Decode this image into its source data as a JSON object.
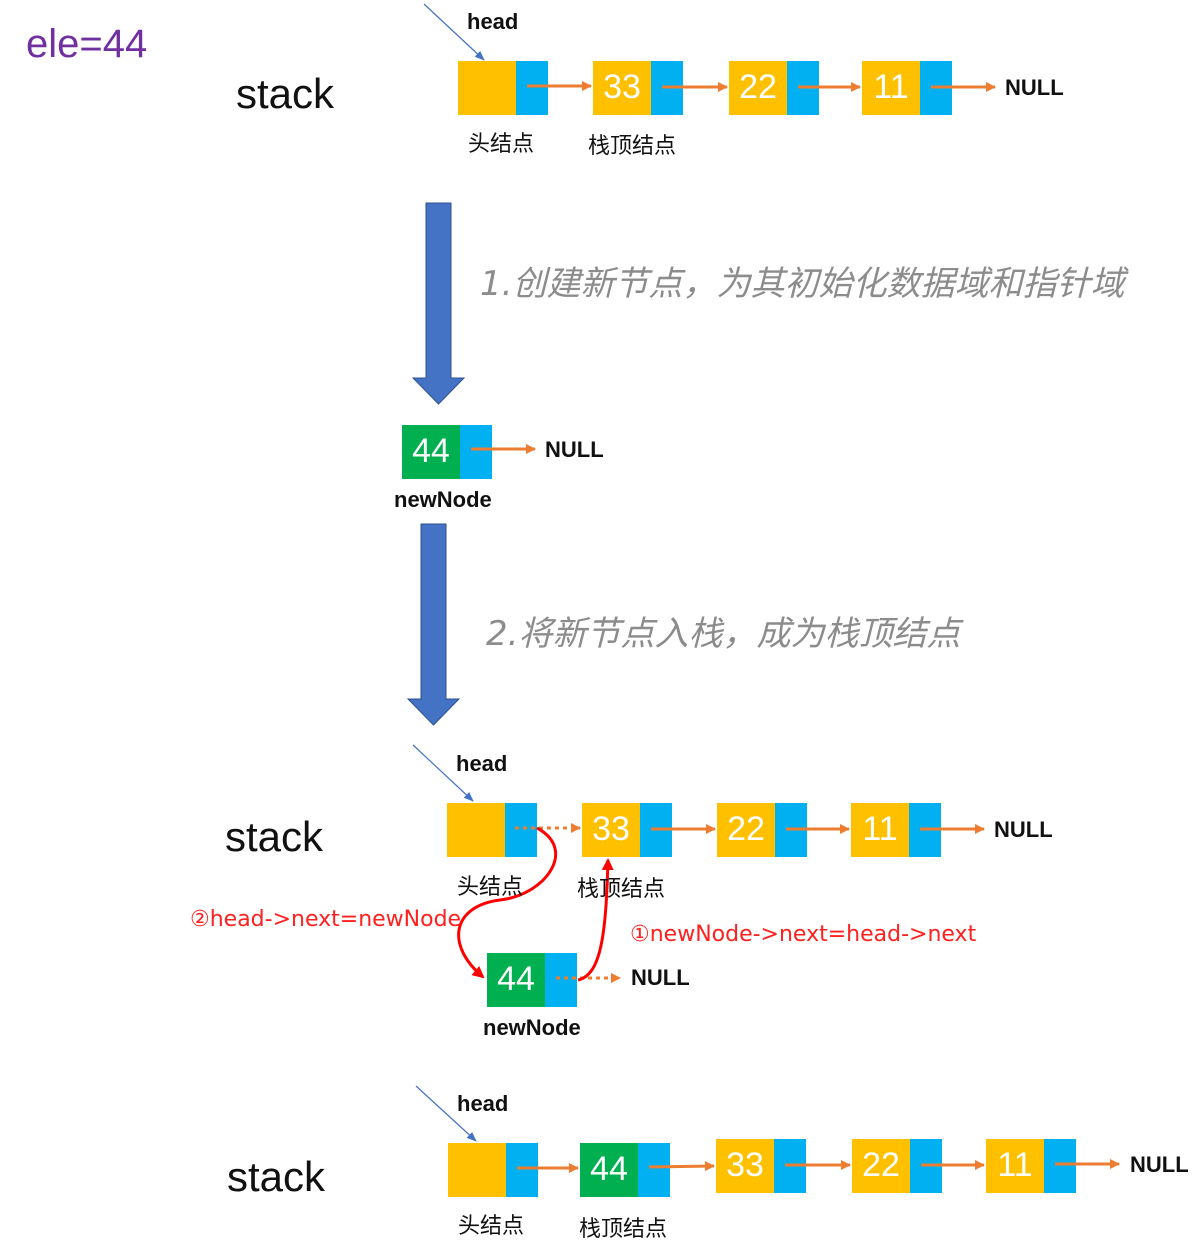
{
  "title": "ele=44",
  "labels": {
    "stack": "stack",
    "head": "head",
    "null": "NULL",
    "head_node": "头结点",
    "top_node": "栈顶结点",
    "new_node": "newNode"
  },
  "steps": {
    "step1": "1.创建新节点，为其初始化数据域和指针域",
    "step2": "2.将新节点入栈，成为栈顶结点"
  },
  "annotations": {
    "op1": "①newNode->next=head->next",
    "op2": "②head->next=newNode"
  },
  "values": {
    "initial": [
      "33",
      "22",
      "11"
    ],
    "new": "44",
    "final": [
      "44",
      "33",
      "22",
      "11"
    ]
  },
  "colors": {
    "data_cell": "#FFC000",
    "pointer_cell": "#00B0F0",
    "new_node_cell": "#00B050",
    "pointer_arrow": "#ED7D31",
    "step_arrow": "#4472C4",
    "head_arrow": "#4472C4",
    "relink_arrow": "#FF0000",
    "title": "#7030A0"
  }
}
